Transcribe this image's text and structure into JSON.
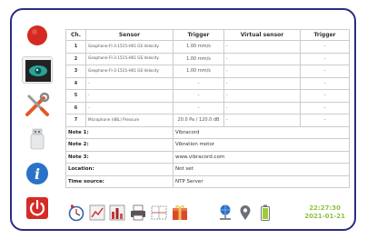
{
  "table": {
    "headers": [
      "Ch.",
      "Sensor",
      "Trigger",
      "Virtual sensor",
      "Trigger"
    ],
    "rows": [
      {
        "ch": "1",
        "sensor": "Geophone-FI-3-1515-H01 GS Velocity",
        "trigger": "1.00 mm/s",
        "vsensor": "-",
        "vtrigger": "-"
      },
      {
        "ch": "2",
        "sensor": "Geophone-FI-3-1515-H01 GS Velocity",
        "trigger": "1.00 mm/s",
        "vsensor": "-",
        "vtrigger": "-"
      },
      {
        "ch": "3",
        "sensor": "Geophone-FI-3-1515-H01 GS Velocity",
        "trigger": "1.00 mm/s",
        "vsensor": "-",
        "vtrigger": "-"
      },
      {
        "ch": "4",
        "sensor": "-",
        "trigger": "-",
        "vsensor": "-",
        "vtrigger": "-"
      },
      {
        "ch": "5",
        "sensor": "-",
        "trigger": "-",
        "vsensor": "-",
        "vtrigger": "-"
      },
      {
        "ch": "6",
        "sensor": "-",
        "trigger": "-",
        "vsensor": "-",
        "vtrigger": "-"
      },
      {
        "ch": "7",
        "sensor": "Microphone (dBL) Pressure",
        "trigger": "20.0 Pa / 120.0 dB",
        "vsensor": "-",
        "vtrigger": "-"
      }
    ]
  },
  "info": {
    "note1_label": "Note 1:",
    "note1_value": "Vibracord",
    "note2_label": "Note 2:",
    "note2_value": "Vibration motor",
    "note3_label": "Note 3:",
    "note3_value": "www.vibracord.com",
    "location_label": "Location:",
    "location_value": "Not set",
    "timesource_label": "Time source:",
    "timesource_value": "NTP Server"
  },
  "clock": {
    "time": "22:27:30",
    "date": "2021-01-21"
  },
  "colors": {
    "frame": "#2a2e7d",
    "record_red": "#d42a22",
    "eye_teal": "#2aa398",
    "info_blue": "#2a72c8",
    "power_red": "#d62b25",
    "clock_green": "#8ac43f"
  },
  "icons": {
    "sidebar": [
      "record-icon",
      "eye-icon",
      "tools-icon",
      "usb-icon",
      "info-icon",
      "power-icon"
    ],
    "toolbar": [
      "timer-icon",
      "chart-icon",
      "bars-icon",
      "printer-icon",
      "grid-icon",
      "gift-icon",
      "network-icon",
      "location-icon",
      "battery-icon"
    ]
  }
}
